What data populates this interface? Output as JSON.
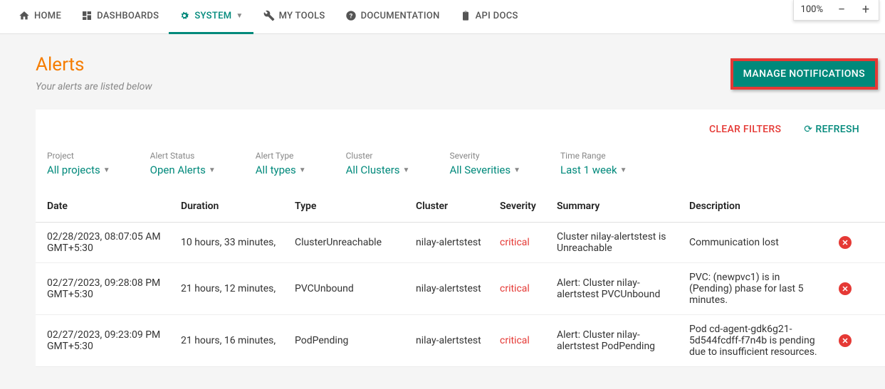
{
  "nav": {
    "home": "HOME",
    "dashboards": "DASHBOARDS",
    "system": "SYSTEM",
    "mytools": "MY TOOLS",
    "documentation": "DOCUMENTATION",
    "apidocs": "API DOCS"
  },
  "zoom": {
    "level": "100%"
  },
  "page": {
    "title": "Alerts",
    "subtitle": "Your alerts are listed below",
    "manage_notifications": "MANAGE NOTIFICATIONS"
  },
  "actions": {
    "clear_filters": "CLEAR FILTERS",
    "refresh": "REFRESH"
  },
  "filters": {
    "project": {
      "label": "Project",
      "value": "All projects"
    },
    "status": {
      "label": "Alert Status",
      "value": "Open Alerts"
    },
    "alert_type": {
      "label": "Alert Type",
      "value": "All types"
    },
    "cluster": {
      "label": "Cluster",
      "value": "All Clusters"
    },
    "severity": {
      "label": "Severity",
      "value": "All Severities"
    },
    "time_range": {
      "label": "Time Range",
      "value": "Last 1 week"
    }
  },
  "columns": {
    "date": "Date",
    "duration": "Duration",
    "type": "Type",
    "cluster": "Cluster",
    "severity": "Severity",
    "summary": "Summary",
    "description": "Description"
  },
  "rows": [
    {
      "date": "02/28/2023, 08:07:05 AM GMT+5:30",
      "duration": "10 hours, 33 minutes,",
      "type": "ClusterUnreachable",
      "cluster": "nilay-alertstest",
      "severity": "critical",
      "summary": "Cluster nilay-alertstest is Unreachable",
      "description": "Communication lost"
    },
    {
      "date": "02/27/2023, 09:28:08 PM GMT+5:30",
      "duration": "21 hours, 12 minutes,",
      "type": "PVCUnbound",
      "cluster": "nilay-alertstest",
      "severity": "critical",
      "summary": "Alert: Cluster nilay-alertstest PVCUnbound",
      "description": "PVC: (newpvc1) is in (Pending) phase for last 5 minutes."
    },
    {
      "date": "02/27/2023, 09:23:09 PM GMT+5:30",
      "duration": "21 hours, 16 minutes,",
      "type": "PodPending",
      "cluster": "nilay-alertstest",
      "severity": "critical",
      "summary": "Alert: Cluster nilay-alertstest PodPending",
      "description": "Pod cd-agent-gdk6g21-5d544fcdff-f7n4b is pending due to insufficient resources."
    }
  ]
}
